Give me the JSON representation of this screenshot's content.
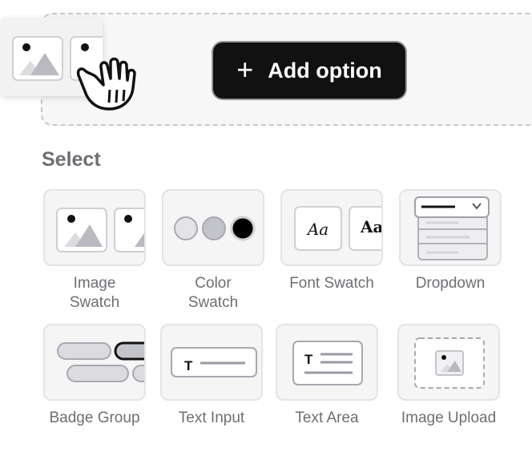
{
  "toolbar": {
    "add_option_label": "Add option"
  },
  "section": {
    "title": "Select"
  },
  "options": [
    {
      "label_line1": "Image",
      "label_line2": "Swatch"
    },
    {
      "label_line1": "Color",
      "label_line2": "Swatch"
    },
    {
      "label": "Font Swatch",
      "sample": "Aa"
    },
    {
      "label": "Dropdown"
    },
    {
      "label": "Badge Group"
    },
    {
      "label": "Text Input",
      "glyph": "T"
    },
    {
      "label": "Text Area",
      "glyph": "T"
    },
    {
      "label": "Image Upload"
    }
  ]
}
